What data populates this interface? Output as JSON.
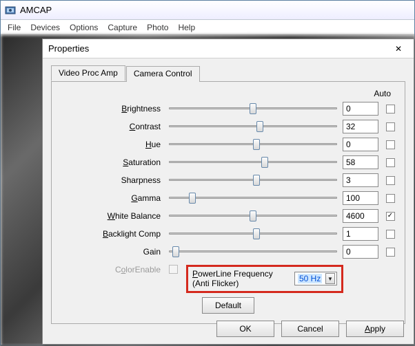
{
  "app": {
    "title": "AMCAP"
  },
  "menu": {
    "items": [
      "File",
      "Devices",
      "Options",
      "Capture",
      "Photo",
      "Help"
    ]
  },
  "dialog": {
    "title": "Properties",
    "tabs": [
      {
        "label": "Video Proc Amp",
        "active": true
      },
      {
        "label": "Camera Control",
        "active": false
      }
    ],
    "auto_header": "Auto",
    "rows": [
      {
        "label": "Brightness",
        "mnemonic": "B",
        "value": "0",
        "pos": 48,
        "auto": false
      },
      {
        "label": "Contrast",
        "mnemonic": "C",
        "value": "32",
        "pos": 52,
        "auto": false
      },
      {
        "label": "Hue",
        "mnemonic": "H",
        "value": "0",
        "pos": 50,
        "auto": false
      },
      {
        "label": "Saturation",
        "mnemonic": "S",
        "value": "58",
        "pos": 55,
        "auto": false
      },
      {
        "label": "Sharpness",
        "mnemonic": "",
        "value": "3",
        "pos": 50,
        "auto": false
      },
      {
        "label": "Gamma",
        "mnemonic": "G",
        "value": "100",
        "pos": 12,
        "auto": false
      },
      {
        "label": "White Balance",
        "mnemonic": "W",
        "value": "4600",
        "pos": 48,
        "auto": true
      },
      {
        "label": "Backlight Comp",
        "mnemonic": "B",
        "value": "1",
        "pos": 50,
        "auto": false
      },
      {
        "label": "Gain",
        "mnemonic": "",
        "value": "0",
        "pos": 2,
        "auto": false
      }
    ],
    "color_enable": {
      "label": "ColorEnable",
      "checked": false,
      "disabled": true
    },
    "powerline": {
      "label": "PowerLine Frequency (Anti Flicker)",
      "selected": "50 Hz"
    },
    "default_btn": "Default",
    "buttons": {
      "ok": "OK",
      "cancel": "Cancel",
      "apply": "Apply"
    }
  }
}
